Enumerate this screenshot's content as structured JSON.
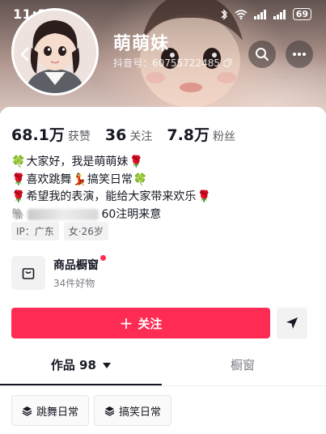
{
  "status_bar": {
    "time": "11:19",
    "battery": "69"
  },
  "profile": {
    "nickname": "萌萌妹",
    "douyin_id": "抖音号：60755722485"
  },
  "stats": [
    {
      "num": "68.1万",
      "label": "获赞"
    },
    {
      "num": "36",
      "label": "关注"
    },
    {
      "num": "7.8万",
      "label": "粉丝"
    }
  ],
  "bio": {
    "line1_prefix": "🍀",
    "line1_text": "大家好，我是萌萌妹",
    "line1_suffix": "🌹",
    "line2_prefix": "🌹",
    "line2_text_a": "喜欢跳舞",
    "line2_mid": "💃",
    "line2_text_b": "搞笑日常",
    "line2_suffix": "🍀",
    "line3_prefix": "🌹",
    "line3_text": "希望我的表演，能给大家带来欢乐",
    "line3_suffix": "🌹",
    "line4_prefix": "🐘",
    "line4_text": "60注明来意"
  },
  "tags": [
    "IP：广东",
    "女·26岁"
  ],
  "shop": {
    "title": "商品橱窗",
    "subtitle": "34件好物"
  },
  "actions": {
    "follow_label": "关注",
    "plus": "+"
  },
  "tabs": {
    "works_label": "作品 98",
    "shop_label": "橱窗"
  },
  "chips": [
    "跳舞日常",
    "搞笑日常"
  ],
  "colors": {
    "accent": "#fe2c55",
    "text": "#161823",
    "muted": "#7b7b84"
  },
  "icons": [
    "back-chevron-icon",
    "search-icon",
    "more-icon",
    "copy-icon",
    "shop-bag-icon",
    "share-arrow-icon",
    "caret-down-icon",
    "stack-icon"
  ]
}
